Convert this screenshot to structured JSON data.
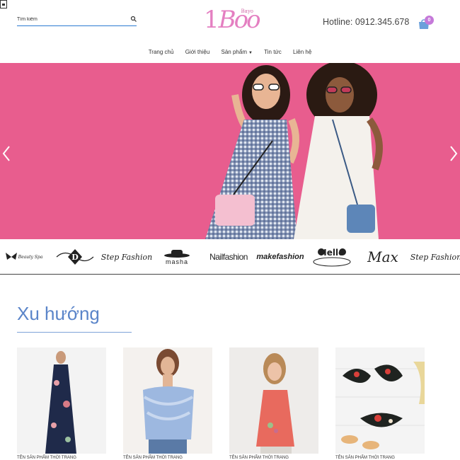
{
  "header": {
    "search_placeholder": "Tìm kiếm",
    "logo_text": "Boo",
    "logo_sub": "Bayo",
    "hotline": "Hotline: 0912.345.678",
    "cart_count": "0"
  },
  "nav": {
    "items": [
      {
        "label": "Trang chủ"
      },
      {
        "label": "Giới thiệu"
      },
      {
        "label": "Sản phẩm"
      },
      {
        "label": "Tin tức"
      },
      {
        "label": "Liên hệ"
      }
    ]
  },
  "brands": [
    {
      "label": "Beauty Spa"
    },
    {
      "label": "D"
    },
    {
      "label": "Step Fashion"
    },
    {
      "label": "masha"
    },
    {
      "label": "Nailfashion"
    },
    {
      "label": "makefashion"
    },
    {
      "label": "Hello"
    },
    {
      "label": "Max"
    },
    {
      "label": "Step Fashion"
    }
  ],
  "trend": {
    "title": "Xu hướng",
    "products": [
      {
        "name": "TÊN SẢN PHẨM THỜI TRANG"
      },
      {
        "name": "TÊN SẢN PHẨM THỜI TRANG"
      },
      {
        "name": "TÊN SẢN PHẨM THỜI TRANG"
      },
      {
        "name": "TÊN SẢN PHẨM THỜI TRANG"
      }
    ]
  },
  "colors": {
    "hero_bg": "#e85d8e",
    "accent_blue": "#5b85c9",
    "logo_pink": "#e47fc1",
    "cart_badge": "#c579d9"
  }
}
